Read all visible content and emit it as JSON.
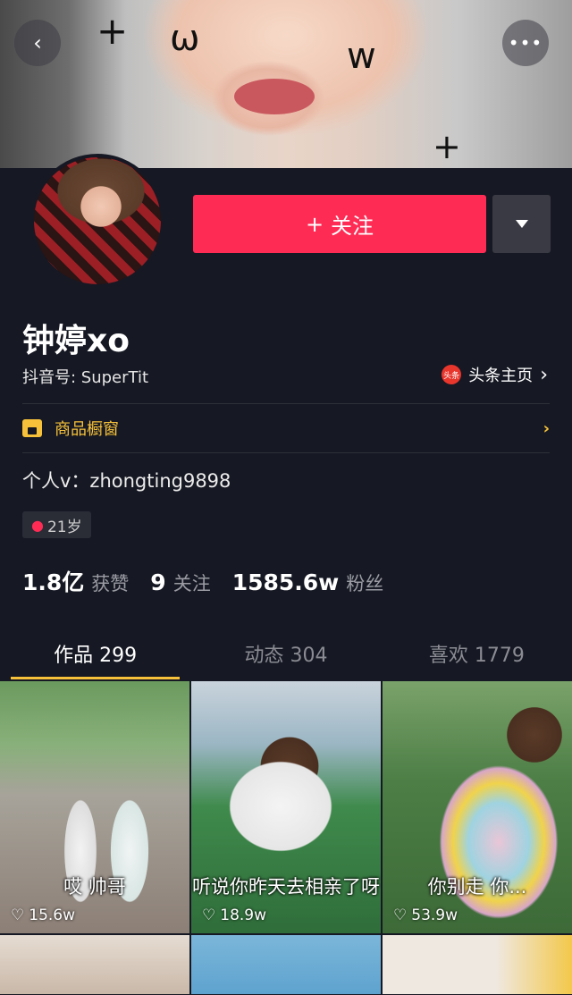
{
  "profile": {
    "nickname": "钟婷xo",
    "douyin_id": "抖音号: SuperTit",
    "toutiao_logo": "头条",
    "toutiao_label": "头条主页",
    "shop_label": "商品橱窗",
    "bio": "个人v：zhongting9898",
    "age": "21岁"
  },
  "actions": {
    "follow_label": "关注",
    "follow_icon": "+"
  },
  "stats": [
    {
      "value": "1.8亿",
      "label": "获赞"
    },
    {
      "value": "9",
      "label": "关注"
    },
    {
      "value": "1585.6w",
      "label": "粉丝"
    }
  ],
  "tabs": [
    {
      "label": "作品 299",
      "active": true
    },
    {
      "label": "动态 304",
      "active": false
    },
    {
      "label": "喜欢 1779",
      "active": false
    }
  ],
  "videos": [
    {
      "caption": "哎 帅哥",
      "likes": "15.6w"
    },
    {
      "caption": "听说你昨天去相亲了呀",
      "likes": "18.9w"
    },
    {
      "caption": "你别走 你...",
      "likes": "53.9w"
    }
  ],
  "colors": {
    "background": "#161823",
    "accent": "#fe2c55",
    "shop": "#f7c23a"
  }
}
